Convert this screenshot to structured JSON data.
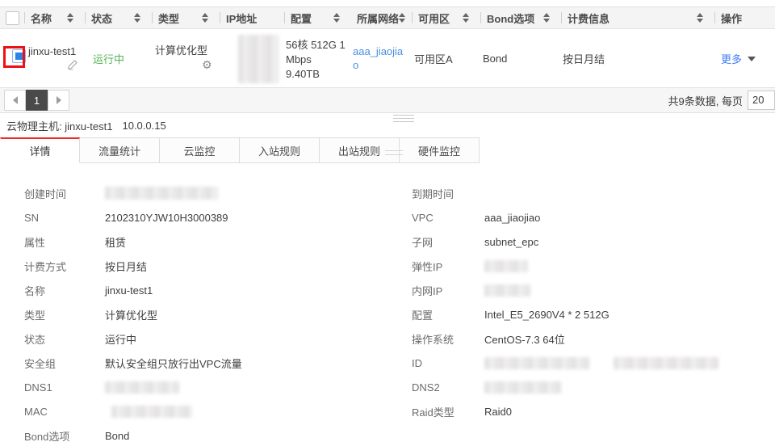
{
  "colors": {
    "accent_red": "#ec2b2b",
    "annotation_red": "#ee1111",
    "status_green": "#55b255",
    "link_blue": "#4a90e2",
    "more_link_blue": "#3d7bf5",
    "header_bg": "#f4f4f4",
    "active_page_bg": "#4a4a4a"
  },
  "icons": {
    "sort": "sort-arrows-icon",
    "edit": "pencil-icon",
    "settings": "gear-icon",
    "prev": "chevron-left-icon",
    "next": "chevron-right-icon",
    "more_caret": "caret-down-icon",
    "drag": "drag-handle-icon"
  },
  "table": {
    "columns": [
      {
        "label": "名称",
        "sortable": true
      },
      {
        "label": "状态",
        "sortable": true
      },
      {
        "label": "类型",
        "sortable": true
      },
      {
        "label": "IP地址",
        "sortable": false
      },
      {
        "label": "配置",
        "sortable": true
      },
      {
        "label": "所属网络",
        "sortable": true
      },
      {
        "label": "可用区",
        "sortable": true
      },
      {
        "label": "Bond选项",
        "sortable": true
      },
      {
        "label": "计费信息",
        "sortable": true
      },
      {
        "label": "操作",
        "sortable": false
      }
    ],
    "row": {
      "selected": true,
      "name": "jinxu-test1",
      "status": "运行中",
      "type": "计算优化型",
      "ip_redacted": true,
      "config_lines": [
        "56核 512G 1",
        "Mbps",
        "9.40TB"
      ],
      "network": "aaa_jiaojiao",
      "zone": "可用区A",
      "bond": "Bond",
      "billing": "按日月结",
      "more_label": "更多"
    }
  },
  "pagination": {
    "current_page": "1",
    "summary": "共9条数据, 每页",
    "page_size": "20"
  },
  "panel": {
    "title": "云物理主机: jinxu-test1",
    "ip": "10.0.0.15",
    "tabs": [
      "详情",
      "流量统计",
      "云监控",
      "入站规则",
      "出站规则",
      "硬件监控"
    ],
    "active_tab": "详情"
  },
  "details": {
    "left": [
      {
        "label": "创建时间",
        "value": "",
        "redacted": true
      },
      {
        "label": "SN",
        "value": "2102310YJW10H3000389"
      },
      {
        "label": "属性",
        "value": "租赁"
      },
      {
        "label": "计费方式",
        "value": "按日月结"
      },
      {
        "label": "名称",
        "value": "jinxu-test1"
      },
      {
        "label": "类型",
        "value": "计算优化型"
      },
      {
        "label": "状态",
        "value": "运行中"
      },
      {
        "label": "安全组",
        "value": "默认安全组只放行出VPC流量"
      },
      {
        "label": "DNS1",
        "value": "",
        "redacted": true
      },
      {
        "label": "MAC",
        "value": "",
        "redacted": true
      },
      {
        "label": "Bond选项",
        "value": "Bond"
      }
    ],
    "right": [
      {
        "label": "到期时间",
        "value": ""
      },
      {
        "label": "VPC",
        "value": "aaa_jiaojiao"
      },
      {
        "label": "子网",
        "value": "subnet_epc"
      },
      {
        "label": "弹性IP",
        "value": "",
        "redacted": true
      },
      {
        "label": "内网IP",
        "value": "",
        "redacted": true
      },
      {
        "label": "配置",
        "value": "Intel_E5_2690V4 * 2 512G"
      },
      {
        "label": "操作系统",
        "value": "CentOS-7.3 64位"
      },
      {
        "label": "ID",
        "value": "",
        "redacted": true,
        "redacted_parts": 2
      },
      {
        "label": "DNS2",
        "value": "",
        "redacted": true
      },
      {
        "label": "Raid类型",
        "value": "Raid0"
      }
    ]
  }
}
